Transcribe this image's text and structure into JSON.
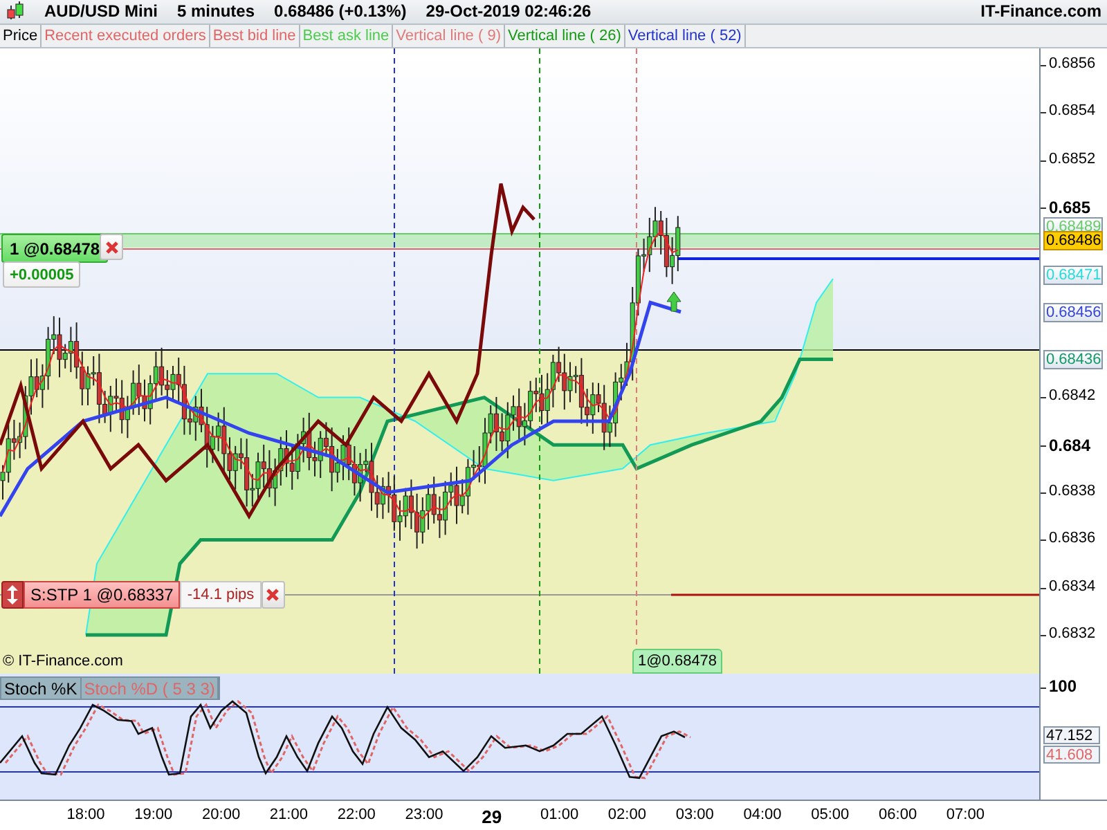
{
  "header": {
    "instrument": "AUD/USD Mini",
    "timeframe": "5 minutes",
    "quote": "0.68486 (+0.13%)",
    "datetime": "29-Oct-2019 02:46:26",
    "brand": "IT-Finance.com"
  },
  "legend": [
    {
      "label": "Price",
      "color": "#000000"
    },
    {
      "label": "Recent executed orders",
      "color": "#e06666"
    },
    {
      "label": "Best bid line",
      "color": "#e06666"
    },
    {
      "label": "Best ask line",
      "color": "#4ccc4c"
    },
    {
      "label": "Vertical line ( 9)",
      "color": "#e07a7a"
    },
    {
      "label": "Vertical line ( 26)",
      "color": "#119911"
    },
    {
      "label": "Vertical line ( 52)",
      "color": "#2233cc"
    }
  ],
  "price_axis": {
    "ticks": [
      {
        "label": "0.6856",
        "major": false
      },
      {
        "label": "0.6854",
        "major": false
      },
      {
        "label": "0.6852",
        "major": false
      },
      {
        "label": "0.685",
        "major": true
      },
      {
        "label": "0.6842",
        "major": false
      },
      {
        "label": "0.684",
        "major": true
      },
      {
        "label": "0.6838",
        "major": false
      },
      {
        "label": "0.6836",
        "major": false
      },
      {
        "label": "0.6834",
        "major": false
      },
      {
        "label": "0.6832",
        "major": false
      }
    ],
    "tags": [
      {
        "label": "0.68489",
        "kind": "line",
        "color": "#66cc66"
      },
      {
        "label": "0.68486",
        "kind": "current",
        "color": "#ffcc00"
      },
      {
        "label": "0.68471",
        "kind": "line",
        "color": "#22dddd"
      },
      {
        "label": "0.68456",
        "kind": "line",
        "color": "#3344dd"
      },
      {
        "label": "0.68436",
        "kind": "line",
        "color": "#119966"
      }
    ]
  },
  "position": {
    "label": "1 @0.68478",
    "gain": "+0.00005",
    "marker": "1@0.68478"
  },
  "stop_order": {
    "label": "S:STP 1 @0.68337",
    "distance": "-14.1 pips"
  },
  "copyright": "© IT-Finance.com",
  "stochastic": {
    "legend": [
      {
        "label": "Stoch %K",
        "kind": "main"
      },
      {
        "label": "Stoch %D ( 5 3 3)",
        "kind": "signal"
      }
    ],
    "axis_label": "100",
    "tags": [
      {
        "label": "47.152",
        "color": "#000000"
      },
      {
        "label": "41.608",
        "color": "#e06666"
      }
    ]
  },
  "time_axis": [
    {
      "label": "18:00",
      "major": false
    },
    {
      "label": "19:00",
      "major": false
    },
    {
      "label": "20:00",
      "major": false
    },
    {
      "label": "21:00",
      "major": false
    },
    {
      "label": "22:00",
      "major": false
    },
    {
      "label": "23:00",
      "major": false
    },
    {
      "label": "29",
      "major": true
    },
    {
      "label": "01:00",
      "major": false
    },
    {
      "label": "02:00",
      "major": false
    },
    {
      "label": "03:00",
      "major": false
    },
    {
      "label": "04:00",
      "major": false
    },
    {
      "label": "05:00",
      "major": false
    },
    {
      "label": "06:00",
      "major": false
    },
    {
      "label": "07:00",
      "major": false
    }
  ]
}
